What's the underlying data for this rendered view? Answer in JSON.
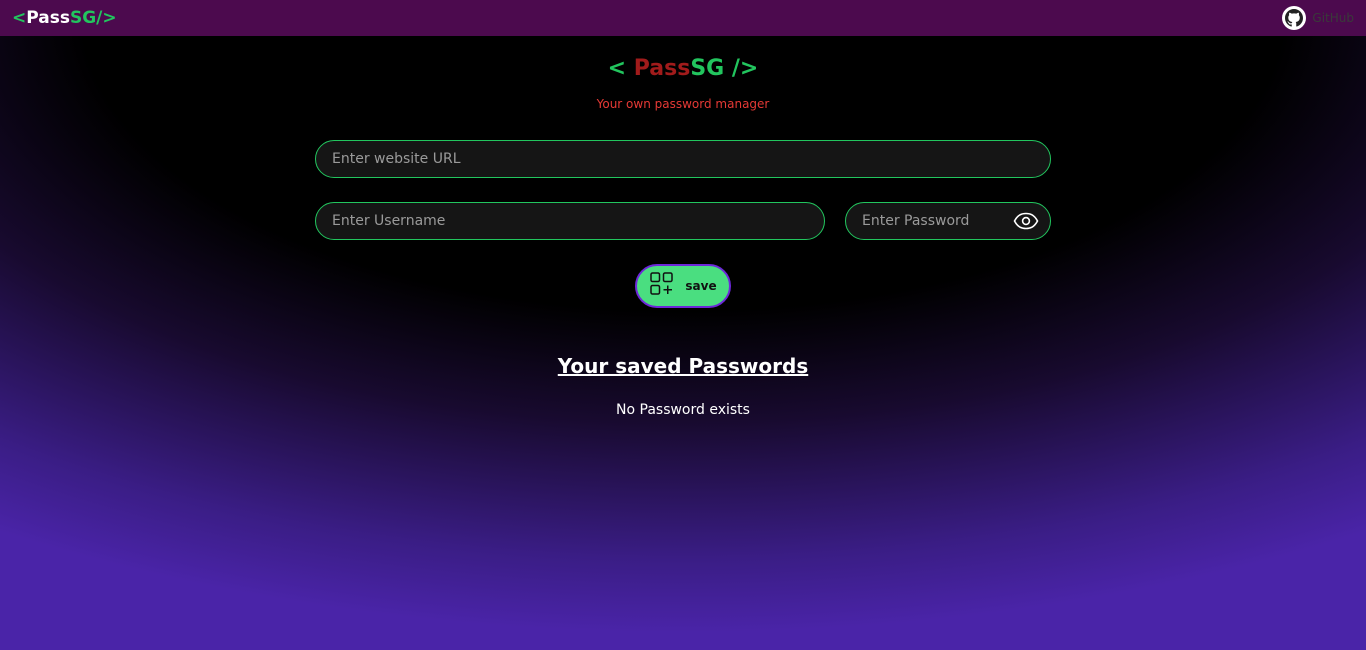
{
  "navbar": {
    "logo": {
      "open": "< ",
      "pass": "Pass",
      "sg": "SG",
      "close": " />"
    },
    "github_label": "GitHub"
  },
  "brand": {
    "open": "< ",
    "pass": "Pass",
    "sg": "SG",
    "close": " />"
  },
  "tagline": "Your own password manager",
  "form": {
    "url_placeholder": "Enter website URL",
    "username_placeholder": "Enter Username",
    "password_placeholder": "Enter Password",
    "save_label": "save"
  },
  "saved": {
    "title": "Your saved Passwords",
    "empty_message": "No Password exists"
  },
  "colors": {
    "navbar_bg": "#4c0a4e",
    "accent_green": "#22c55e",
    "button_green": "#4ade80",
    "brand_red": "#a11b1b",
    "tagline_red": "#e53935"
  },
  "icons": {
    "github": "github-icon",
    "eye": "eye-icon",
    "save": "grid-plus-icon"
  }
}
